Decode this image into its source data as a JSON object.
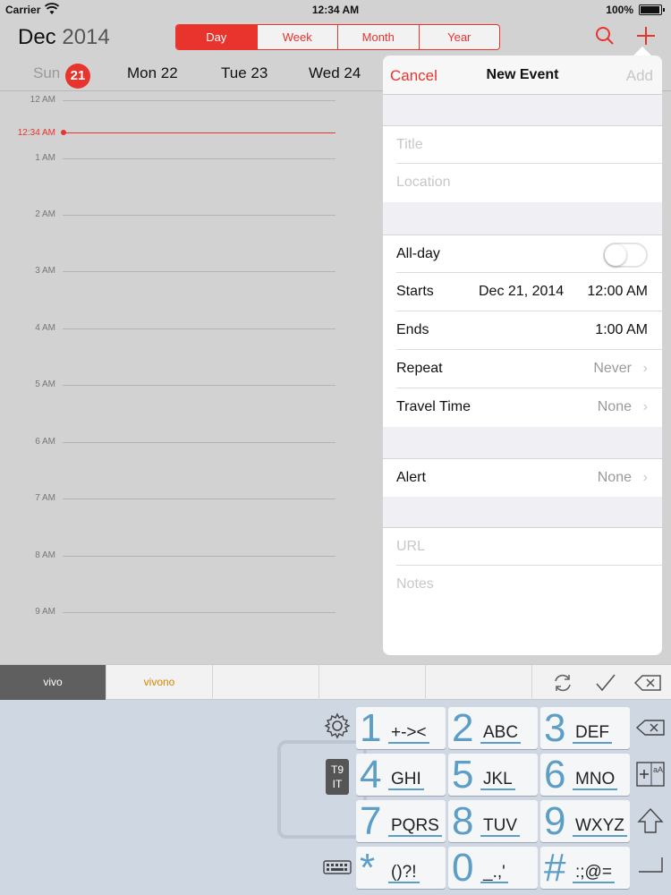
{
  "status_bar": {
    "carrier": "Carrier",
    "time": "12:34 AM",
    "battery": "100%",
    "battery_level": 1.0
  },
  "header": {
    "month": "Dec",
    "year": "2014",
    "segments": [
      "Day",
      "Week",
      "Month",
      "Year"
    ],
    "active_segment": "Day"
  },
  "days": [
    {
      "name": "Sun",
      "date": "21",
      "today": true
    },
    {
      "name": "Mon 22"
    },
    {
      "name": "Tue 23"
    },
    {
      "name": "Wed 24"
    }
  ],
  "timeline": {
    "hours": [
      "12 AM",
      "1 AM",
      "2 AM",
      "3 AM",
      "4 AM",
      "5 AM",
      "6 AM",
      "7 AM",
      "8 AM",
      "9 AM"
    ],
    "now_label": "12:34 AM"
  },
  "new_event": {
    "cancel": "Cancel",
    "title": "New Event",
    "add": "Add",
    "title_placeholder": "Title",
    "location_placeholder": "Location",
    "all_day_label": "All-day",
    "all_day_on": false,
    "starts_label": "Starts",
    "starts_date": "Dec 21, 2014",
    "starts_time": "12:00 AM",
    "ends_label": "Ends",
    "ends_time": "1:00 AM",
    "repeat_label": "Repeat",
    "repeat_value": "Never",
    "travel_label": "Travel Time",
    "travel_value": "None",
    "alert_label": "Alert",
    "alert_value": "None",
    "url_placeholder": "URL",
    "notes_placeholder": "Notes"
  },
  "keyboard": {
    "candidates": [
      "vivo",
      "vivono"
    ],
    "mode_badge_top": "T9",
    "mode_badge_bottom": "IT",
    "keys": [
      {
        "num": "1",
        "letters": "+-><"
      },
      {
        "num": "2",
        "letters": "ABC"
      },
      {
        "num": "3",
        "letters": "DEF"
      },
      {
        "num": "4",
        "letters": "GHI"
      },
      {
        "num": "5",
        "letters": "JKL"
      },
      {
        "num": "6",
        "letters": "MNO"
      },
      {
        "num": "7",
        "letters": "PQRS"
      },
      {
        "num": "8",
        "letters": "TUV"
      },
      {
        "num": "9",
        "letters": "WXYZ"
      },
      {
        "num": "*",
        "letters": "()?!"
      },
      {
        "num": "0",
        "letters": "_.,'"
      },
      {
        "num": "#",
        "letters": ":;@="
      }
    ]
  },
  "colors": {
    "accent": "#e8342c",
    "key_digit": "#5c9ec5",
    "candidate_alt": "#d48500"
  }
}
